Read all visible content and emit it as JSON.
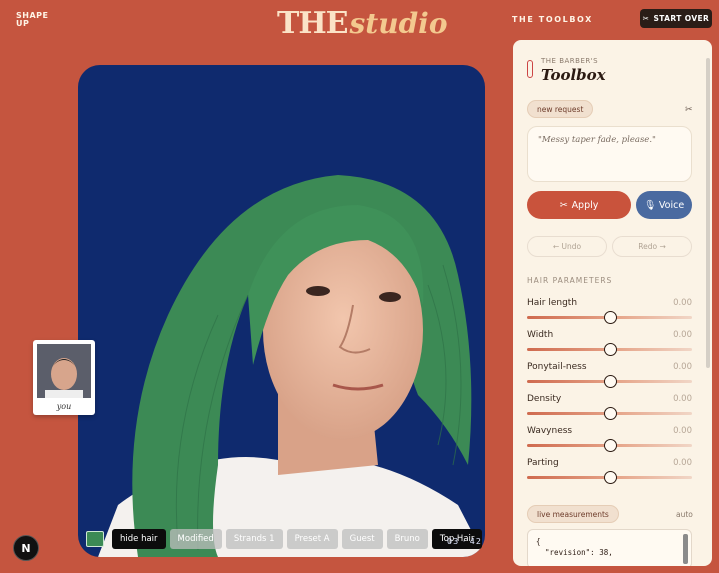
{
  "header": {
    "brand_line1": "SHAPE",
    "brand_line2": "UP",
    "logo_the": "THE",
    "logo_studio": "studio",
    "nav_link": "THE TOOLBOX",
    "start_over": "START OVER"
  },
  "stage": {
    "counter": "03 · 42",
    "toggle_label": "hide hair",
    "chips": [
      "Modified",
      "Strands 1",
      "Preset A",
      "Guest",
      "Bruno",
      "Top Hair"
    ],
    "swatch_color": "#3c8a55"
  },
  "polaroid": {
    "caption": "you"
  },
  "corner_button": "N",
  "panel": {
    "subtitle": "THE BARBER'S",
    "title": "Toolbox",
    "new_request": "new request",
    "request_text": "\"Messy taper fade, please.\"",
    "apply": "Apply",
    "voice": "Voice",
    "undo": "← Undo",
    "redo": "Redo →",
    "section_title": "HAIR PARAMETERS",
    "params": [
      {
        "label": "Hair length",
        "value": "0.00",
        "position": 0.5
      },
      {
        "label": "Width",
        "value": "0.00",
        "position": 0.5
      },
      {
        "label": "Ponytail-ness",
        "value": "0.00",
        "position": 0.5
      },
      {
        "label": "Density",
        "value": "0.00",
        "position": 0.5
      },
      {
        "label": "Wavyness",
        "value": "0.00",
        "position": 0.5
      },
      {
        "label": "Parting",
        "value": "0.00",
        "position": 0.5
      }
    ],
    "live_measurements": "live measurements",
    "auto_label": "auto",
    "code_line1": "{",
    "code_line2": "  \"revision\": 38,"
  },
  "colors": {
    "background": "#c5553f",
    "apply": "#c9533c",
    "voice": "#4a6aa0",
    "hair": "#3c8a55",
    "stage_bg": "#0f2a6e"
  }
}
